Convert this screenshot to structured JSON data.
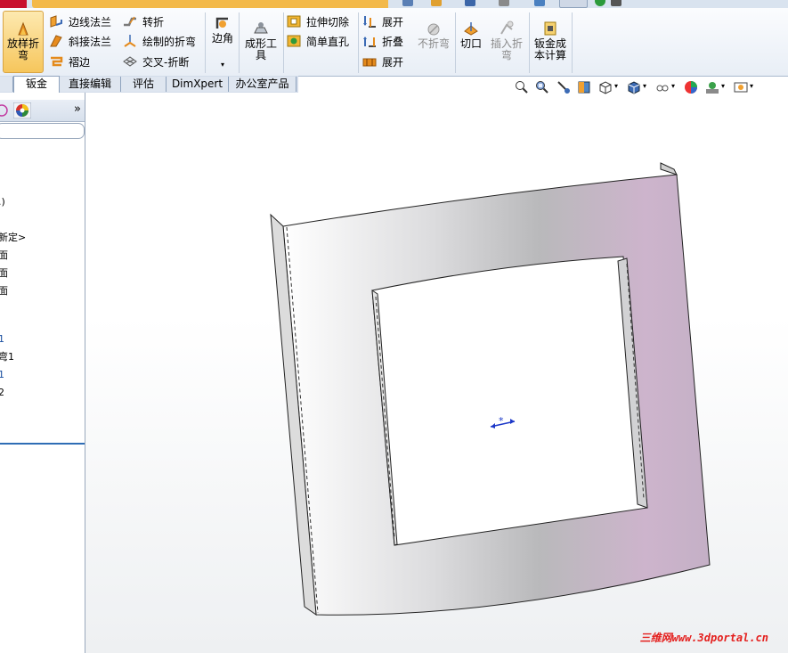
{
  "ribbon": {
    "lofted_bend": "放样折\n弯",
    "edge_flange": "边线法兰",
    "miter_flange": "斜接法兰",
    "hem": "褶边",
    "jog": "转折",
    "sketched_bend": "绘制的折弯",
    "cross_break": "交叉-折断",
    "corners": "边角",
    "forming_tool": "成形工\n具",
    "extruded_cut": "拉伸切除",
    "simple_hole": "简单直孔",
    "unfold": "展开",
    "fold": "折叠",
    "flatten": "展开",
    "no_bends": "不折弯",
    "rip": "切口",
    "insert_bends": "插入折\n弯",
    "sheet_metal_cost": "钣金成\n本计算"
  },
  "tabs": [
    {
      "label": "钣金",
      "active": true
    },
    {
      "label": "直接编辑",
      "active": false
    },
    {
      "label": "评估",
      "active": false
    },
    {
      "label": "DimXpert",
      "active": false
    },
    {
      "label": "办公室产品",
      "active": false
    }
  ],
  "left_panel": {
    "collapse_glyph": "»",
    "tree": [
      {
        "text": ".)",
        "color": "#000000"
      },
      {
        "text": "新定>",
        "color": "#000000"
      },
      {
        "text": "面",
        "color": "#000000"
      },
      {
        "text": "面",
        "color": "#000000"
      },
      {
        "text": "面",
        "color": "#000000"
      },
      {
        "text": "1",
        "color": "#1a4fa0"
      },
      {
        "text": "弯1",
        "color": "#000000"
      },
      {
        "text": "1",
        "color": "#1a4fa0"
      },
      {
        "text": "2",
        "color": "#000000"
      }
    ]
  },
  "watermark": "三维网www.3dportal.cn",
  "colors": {
    "part_light": "#ffffff",
    "part_mid": "#b9b9bb",
    "part_pink": "#cdb4cc",
    "selection_blue": "#1c38c8"
  }
}
